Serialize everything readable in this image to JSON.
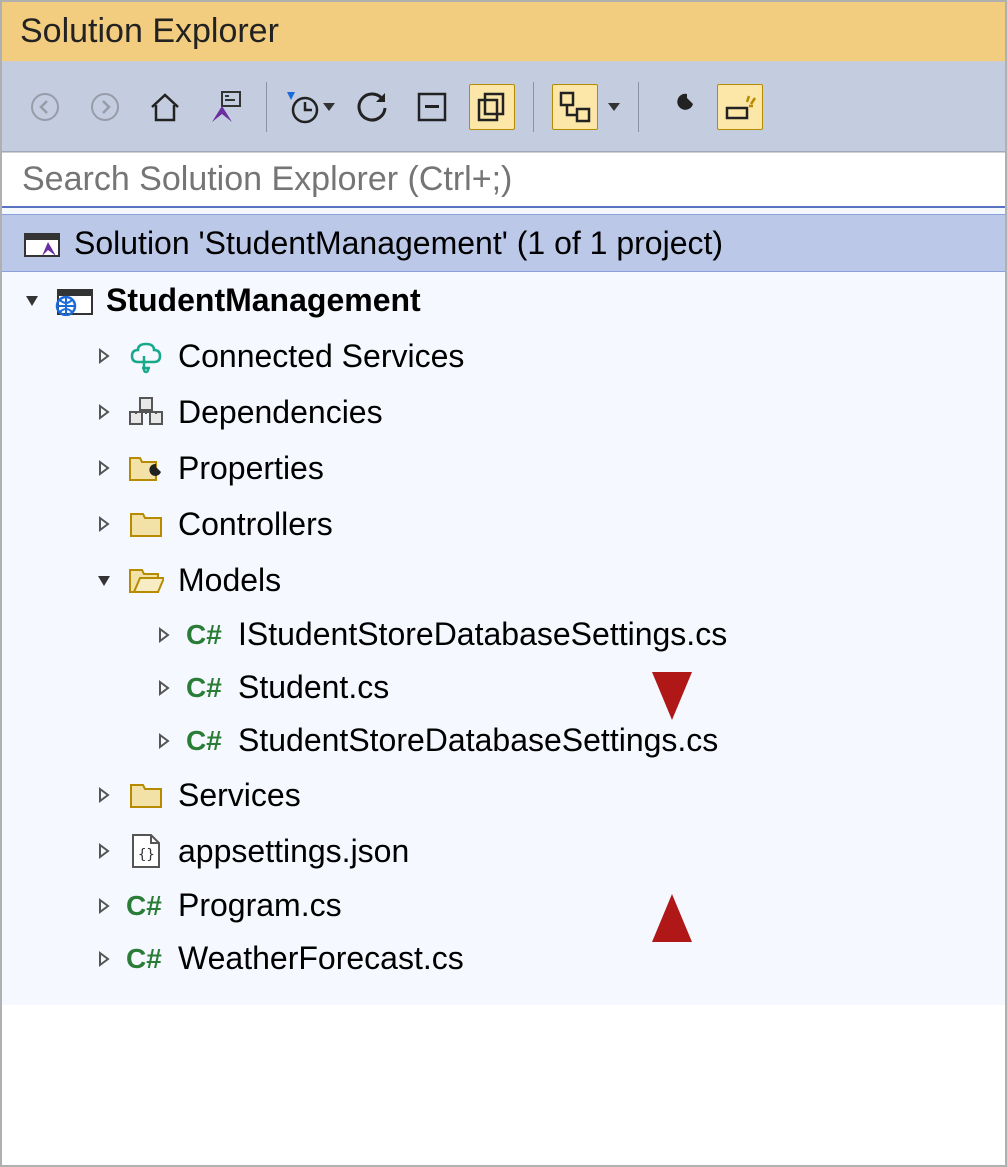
{
  "title": "Solution Explorer",
  "search": {
    "placeholder": "Search Solution Explorer (Ctrl+;)"
  },
  "solution": {
    "label": "Solution 'StudentManagement' (1 of 1 project)",
    "project": {
      "name": "StudentManagement",
      "nodes": {
        "connected_services": "Connected Services",
        "dependencies": "Dependencies",
        "properties": "Properties",
        "controllers": "Controllers",
        "models": {
          "label": "Models",
          "files": [
            "IStudentStoreDatabaseSettings.cs",
            "Student.cs",
            "StudentStoreDatabaseSettings.cs"
          ]
        },
        "services": "Services",
        "appsettings": "appsettings.json",
        "program": "Program.cs",
        "weather": "WeatherForecast.cs"
      }
    }
  }
}
